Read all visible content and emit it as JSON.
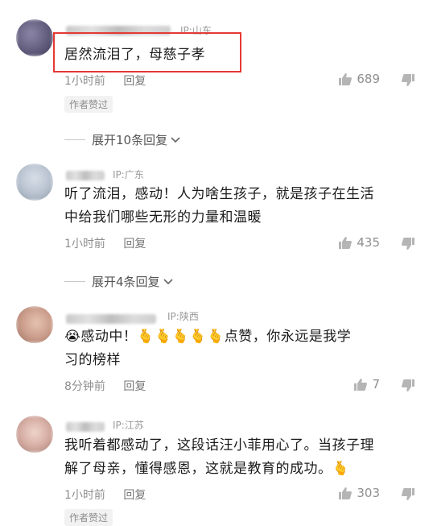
{
  "comments": [
    {
      "ip": "IP:山东",
      "text": "居然流泪了，母慈子孝",
      "time": "1小时前",
      "reply": "回复",
      "likes": "689",
      "badge": "作者赞过",
      "expand": "展开10条回复"
    },
    {
      "ip": "IP:广东",
      "text_line1": "听了流泪，感动！人为啥生孩子，就是孩子在生活",
      "text_line2": "中给我们哪些无形的力量和温暖",
      "time": "1小时前",
      "reply": "回复",
      "likes": "435",
      "expand": "展开4条回复"
    },
    {
      "ip": "IP:陕西",
      "emoji_cry": "😭",
      "text_a": "感动中！",
      "emoji_hand": "🫰",
      "text_b": "点赞，你永远是我学",
      "text_line2": "习的榜样",
      "time": "8分钟前",
      "reply": "回复",
      "likes": "7"
    },
    {
      "ip": "IP:江苏",
      "text_line1": "我听着都感动了，这段话汪小菲用心了。当孩子理",
      "text_line2": "解了母亲，懂得感恩，这就是教育的成功。",
      "emoji_hand": "🫰",
      "time": "1小时前",
      "reply": "回复",
      "likes": "303",
      "badge": "作者赞过"
    }
  ],
  "colors": {
    "highlight_border": "#e53935",
    "muted_text": "#8e8e8e"
  }
}
